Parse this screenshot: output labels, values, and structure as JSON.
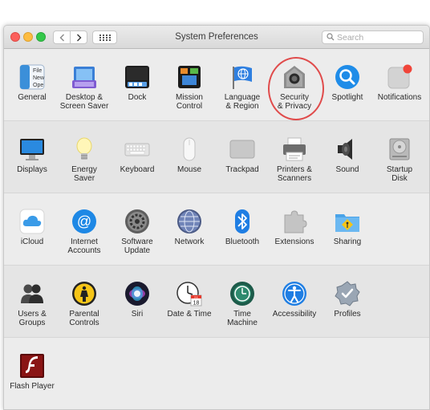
{
  "window": {
    "title": "System Preferences",
    "search_placeholder": "Search",
    "back_label": "<",
    "forward_label": ">"
  },
  "sections": [
    {
      "items": [
        {
          "label": "General",
          "icon": "general-icon"
        },
        {
          "label": "Desktop &\nScreen Saver",
          "icon": "desktop-screen-saver-icon"
        },
        {
          "label": "Dock",
          "icon": "dock-icon"
        },
        {
          "label": "Mission\nControl",
          "icon": "mission-control-icon"
        },
        {
          "label": "Language\n& Region",
          "icon": "language-region-icon"
        },
        {
          "label": "Security\n& Privacy",
          "icon": "security-privacy-icon"
        },
        {
          "label": "Spotlight",
          "icon": "spotlight-icon"
        },
        {
          "label": "Notifications",
          "icon": "notifications-icon"
        }
      ]
    },
    {
      "items": [
        {
          "label": "Displays",
          "icon": "displays-icon"
        },
        {
          "label": "Energy\nSaver",
          "icon": "energy-saver-icon"
        },
        {
          "label": "Keyboard",
          "icon": "keyboard-icon"
        },
        {
          "label": "Mouse",
          "icon": "mouse-icon"
        },
        {
          "label": "Trackpad",
          "icon": "trackpad-icon"
        },
        {
          "label": "Printers &\nScanners",
          "icon": "printers-scanners-icon"
        },
        {
          "label": "Sound",
          "icon": "sound-icon"
        },
        {
          "label": "Startup\nDisk",
          "icon": "startup-disk-icon"
        }
      ]
    },
    {
      "items": [
        {
          "label": "iCloud",
          "icon": "icloud-icon"
        },
        {
          "label": "Internet\nAccounts",
          "icon": "internet-accounts-icon"
        },
        {
          "label": "Software\nUpdate",
          "icon": "software-update-icon"
        },
        {
          "label": "Network",
          "icon": "network-icon"
        },
        {
          "label": "Bluetooth",
          "icon": "bluetooth-icon"
        },
        {
          "label": "Extensions",
          "icon": "extensions-icon"
        },
        {
          "label": "Sharing",
          "icon": "sharing-icon"
        }
      ]
    },
    {
      "items": [
        {
          "label": "Users &\nGroups",
          "icon": "users-groups-icon"
        },
        {
          "label": "Parental\nControls",
          "icon": "parental-controls-icon"
        },
        {
          "label": "Siri",
          "icon": "siri-icon"
        },
        {
          "label": "Date & Time",
          "icon": "date-time-icon"
        },
        {
          "label": "Time\nMachine",
          "icon": "time-machine-icon"
        },
        {
          "label": "Accessibility",
          "icon": "accessibility-icon"
        },
        {
          "label": "Profiles",
          "icon": "profiles-icon"
        }
      ]
    },
    {
      "items": [
        {
          "label": "Flash Player",
          "icon": "flash-player-icon"
        }
      ]
    }
  ],
  "general_icon_text": [
    "File",
    "New",
    "Ope"
  ],
  "date_icon_text": {
    "month": "JUL",
    "day": "18"
  },
  "highlight_target": "Security & Privacy",
  "colors": {
    "highlight_ring": "#e04b4b",
    "close": "#fc605c",
    "minimize": "#fdbc40",
    "maximize": "#34c84a"
  }
}
